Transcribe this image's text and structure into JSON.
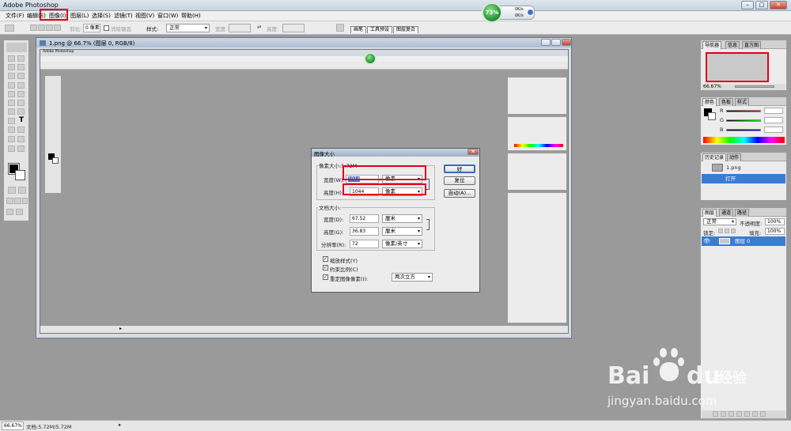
{
  "app": {
    "title": "Adobe Photoshop"
  },
  "menu": [
    "文件(F)",
    "编辑(E)",
    "图像(I)",
    "图层(L)",
    "选择(S)",
    "滤镜(T)",
    "视图(V)",
    "窗口(W)",
    "帮助(H)"
  ],
  "options": {
    "feather_label": "羽化:",
    "feather_value": "0 像素",
    "antialias_label": "消除锯齿",
    "style_label": "样式:",
    "style_value": "正常",
    "width_label": "宽度:",
    "height_label": "高度:",
    "tabs": [
      "画笔",
      "工具预设",
      "图层复合"
    ]
  },
  "gadget": {
    "percent": "73%",
    "up": "0K/s",
    "down": "0K/s"
  },
  "document": {
    "title": "1.png @ 66.7% (图层 0, RGB/8)",
    "inner_title": "Adobe Photoshop",
    "inner_zoom": "66.67%"
  },
  "dialog": {
    "title": "图像大小",
    "pixel_group": "像素大小:5.72M",
    "width_label": "宽度(W):",
    "width_value": "1914",
    "width_unit": "像素",
    "height_label": "高度(H):",
    "height_value": "1044",
    "height_unit": "像素",
    "doc_group": "文档大小:",
    "doc_width_label": "宽度(D):",
    "doc_width_value": "67.52",
    "doc_width_unit": "厘米",
    "doc_height_label": "高度(G):",
    "doc_height_value": "36.83",
    "doc_height_unit": "厘米",
    "res_label": "分辨率(R):",
    "res_value": "72",
    "res_unit": "像素/英寸",
    "scale_styles": "缩放样式(Y)",
    "constrain": "约束比例(C)",
    "resample": "重定图像像素(I):",
    "resample_method": "两次立方",
    "ok": "好",
    "reset": "复位",
    "auto": "自动(A)..."
  },
  "panels": {
    "navigator": {
      "tabs": [
        "导航器",
        "信息",
        "直方图"
      ],
      "zoom": "66.67%"
    },
    "color": {
      "tabs": [
        "颜色",
        "色板",
        "样式"
      ],
      "r": "R",
      "g": "G",
      "b": "B"
    },
    "history": {
      "tabs": [
        "历史记录",
        "动作"
      ],
      "items": [
        "1.png",
        "打开"
      ]
    },
    "layers": {
      "tabs": [
        "图层",
        "通道",
        "路径"
      ],
      "blend": "正常",
      "opacity_label": "不透明度:",
      "opacity_value": "100%",
      "lock_label": "锁定:",
      "fill_label": "填充:",
      "fill_value": "100%",
      "layer_name": "图层 0"
    }
  },
  "status": {
    "zoom": "66.67%",
    "doc": "文档:5.72M/5.72M"
  },
  "watermark": {
    "brand": "Bai",
    "brand2": "du",
    "cn": "经验",
    "url": "jingyan.baidu.com"
  },
  "colors": {
    "highlight_red": "#e0001a",
    "selection_blue": "#3a7bd5"
  }
}
